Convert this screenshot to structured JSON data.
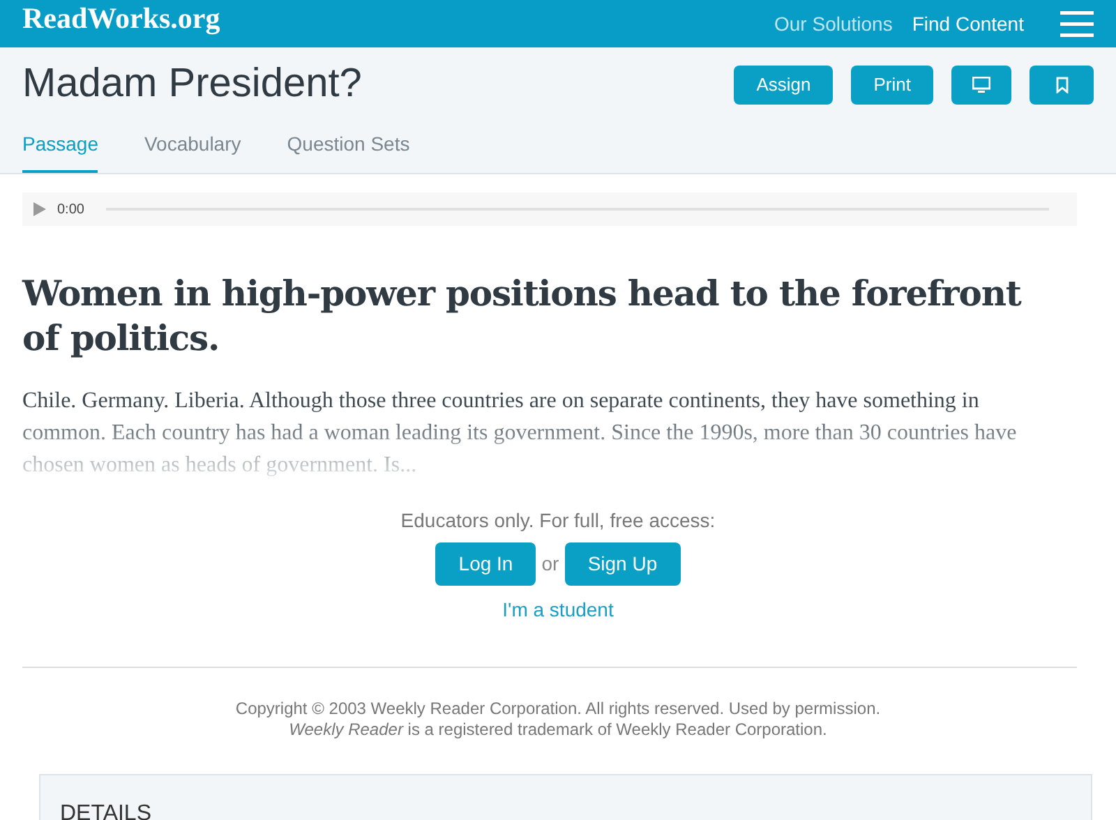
{
  "header": {
    "logo": "ReadWorks.org",
    "nav": [
      "Our Solutions",
      "Find Content"
    ]
  },
  "title_bar": {
    "title": "Madam President?",
    "buttons": [
      {
        "kind": "text",
        "label": "Assign"
      },
      {
        "kind": "text",
        "label": "Print"
      },
      {
        "kind": "monitor"
      },
      {
        "kind": "bookmark"
      }
    ]
  },
  "tabs": [
    {
      "label": "Passage",
      "selected": true
    },
    {
      "label": "Vocabulary",
      "selected": false
    },
    {
      "label": "Question Sets",
      "selected": false
    }
  ],
  "audio": {
    "time": "0:00"
  },
  "headline": "Women in high-power positions head to the forefront of politics.",
  "excerpt": "Chile. Germany. Liberia. Although those three countries are on separate continents, they have something in common. Each country has had a woman leading its government. Since the 1990s, more than 30 countries have chosen women as heads of government. Is...",
  "access": {
    "prompt": "Educators only. For full, free access:",
    "login": "Log In",
    "or": "or",
    "signup": "Sign Up",
    "student": "I'm a student"
  },
  "copyright": [
    "Copyright © 2003 Weekly Reader Corporation. All rights reserved. Used by permission.",
    "*Weekly Reader* is a registered trademark of Weekly Reader Corporation."
  ],
  "details": {
    "title": "DETAILS"
  }
}
